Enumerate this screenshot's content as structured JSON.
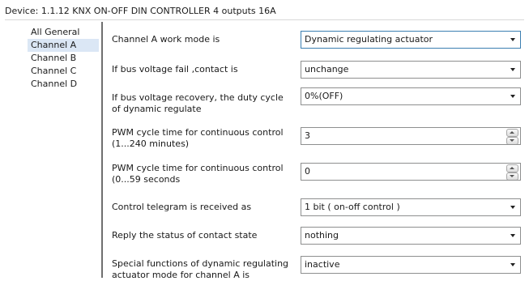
{
  "device_title": "Device: 1.1.12  KNX ON-OFF DIN CONTROLLER 4 outputs 16A",
  "sidebar": {
    "items": [
      {
        "label": "All General"
      },
      {
        "label": "Channel A"
      },
      {
        "label": "Channel B"
      },
      {
        "label": "Channel C"
      },
      {
        "label": "Channel D"
      }
    ],
    "selected": "Channel A"
  },
  "params": [
    {
      "label": "Channel A work mode is",
      "control": "dropdown",
      "value": "Dynamic regulating actuator"
    },
    {
      "label": "If bus voltage fail ,contact is",
      "control": "dropdown",
      "value": "unchange"
    },
    {
      "label": "If bus voltage recovery, the duty cycle of dynamic regulate",
      "control": "dropdown",
      "value": "0%(OFF)"
    },
    {
      "label": "PWM cycle time for continuous control (1...240 minutes)",
      "control": "spinbox",
      "value": "3"
    },
    {
      "label": "PWM cycle time for continuous control (0...59 seconds",
      "control": "spinbox",
      "value": "0"
    },
    {
      "label": "Control telegram is received as",
      "control": "dropdown",
      "value": "1 bit ( on-off control )"
    },
    {
      "label": "Reply the status of contact state",
      "control": "dropdown",
      "value": "nothing"
    },
    {
      "label": "Special functions of dynamic regulating actuator mode for channel A is",
      "control": "dropdown",
      "value": "inactive"
    }
  ],
  "colors": {
    "selected_bg": "#dbe7f5",
    "active_border": "#3c7fb1",
    "divider": "#6f6f6f"
  }
}
